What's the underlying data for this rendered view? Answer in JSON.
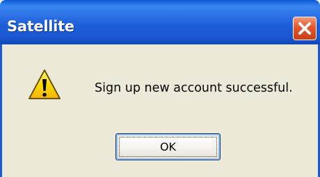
{
  "dialog": {
    "title": "Satellite",
    "message": "Sign up new account successful.",
    "ok_label": "OK",
    "icon": "warning-icon",
    "close_icon": "close-icon"
  },
  "colors": {
    "titlebar": "#1c5cd6",
    "close_button": "#e2572e",
    "body_background": "#ece9d8",
    "warning_yellow": "#ffd800"
  }
}
